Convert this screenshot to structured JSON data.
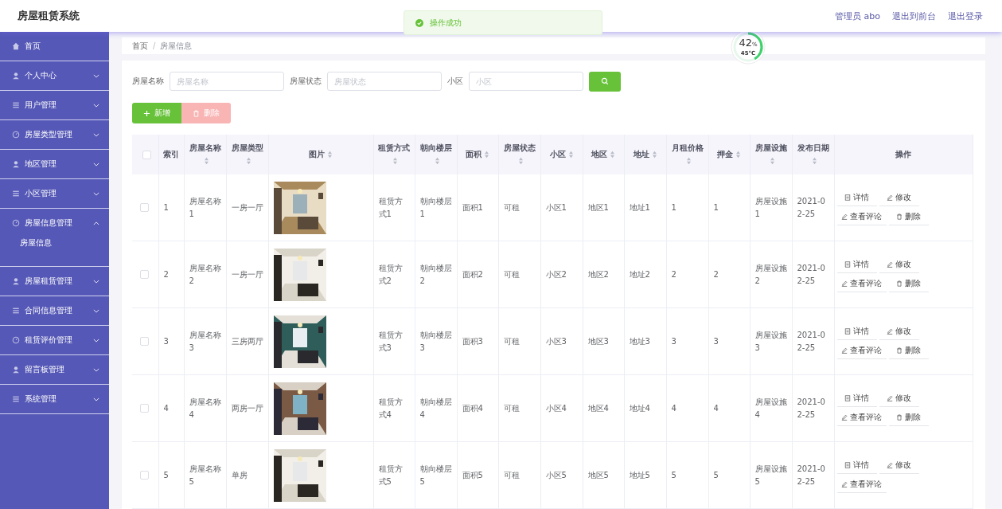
{
  "app": {
    "title": "房屋租赁系统"
  },
  "header_links": [
    "管理员 abo",
    "退出到前台",
    "退出登录"
  ],
  "toast": {
    "message": "操作成功"
  },
  "gauge": {
    "percent": "42",
    "unit": "%",
    "temperature": "45°C",
    "level": 0.42
  },
  "sidebar": {
    "items": [
      {
        "label": "首页"
      },
      {
        "label": "个人中心",
        "expanded": false
      },
      {
        "label": "用户管理",
        "expanded": false
      },
      {
        "label": "房屋类型管理",
        "expanded": false
      },
      {
        "label": "地区管理",
        "expanded": false
      },
      {
        "label": "小区管理",
        "expanded": false
      },
      {
        "label": "房屋信息管理",
        "expanded": true,
        "children": [
          {
            "label": "房屋信息"
          }
        ]
      },
      {
        "label": "房屋租赁管理",
        "expanded": false
      },
      {
        "label": "合同信息管理",
        "expanded": false
      },
      {
        "label": "租赁评价管理",
        "expanded": false
      },
      {
        "label": "留言板管理",
        "expanded": false
      },
      {
        "label": "系统管理",
        "expanded": false
      }
    ]
  },
  "breadcrumb": {
    "items": [
      "首页",
      "房屋信息"
    ],
    "separator": "/"
  },
  "search": {
    "fields": [
      {
        "label": "房屋名称",
        "placeholder": "房屋名称"
      },
      {
        "label": "房屋状态",
        "placeholder": "房屋状态"
      },
      {
        "label": "小区",
        "placeholder": "小区"
      }
    ]
  },
  "toolbar": [
    {
      "label": "新增",
      "kind": "add",
      "disabled": false
    },
    {
      "label": "删除",
      "kind": "delete",
      "disabled": true
    }
  ],
  "table": {
    "select_all_checked": false,
    "columns": [
      {
        "label": "索引",
        "sortable": false
      },
      {
        "label": "房屋名称",
        "sortable": true
      },
      {
        "label": "房屋类型",
        "sortable": true
      },
      {
        "label": "图片",
        "sortable": true
      },
      {
        "label": "租赁方式",
        "sortable": true
      },
      {
        "label": "朝向楼层",
        "sortable": true
      },
      {
        "label": "面积",
        "sortable": true
      },
      {
        "label": "房屋状态",
        "sortable": true
      },
      {
        "label": "小区",
        "sortable": true
      },
      {
        "label": "地区",
        "sortable": true
      },
      {
        "label": "地址",
        "sortable": true
      },
      {
        "label": "月租价格",
        "sortable": true
      },
      {
        "label": "押金",
        "sortable": true
      },
      {
        "label": "房屋设施",
        "sortable": true
      },
      {
        "label": "发布日期",
        "sortable": true
      },
      {
        "label": "操作",
        "sortable": false
      }
    ],
    "rows": [
      {
        "checked": false,
        "cells": [
          {
            "kind": "text",
            "text": "1"
          },
          {
            "kind": "text",
            "text": "房屋名称1"
          },
          {
            "kind": "text",
            "text": "一房一厅"
          },
          {
            "kind": "picture"
          },
          {
            "kind": "text",
            "text": "租赁方式1"
          },
          {
            "kind": "text",
            "text": "朝向楼层1"
          },
          {
            "kind": "text",
            "text": "面积1"
          },
          {
            "kind": "text",
            "text": "可租"
          },
          {
            "kind": "text",
            "text": "小区1"
          },
          {
            "kind": "text",
            "text": "地区1"
          },
          {
            "kind": "text",
            "text": "地址1"
          },
          {
            "kind": "text",
            "text": "1"
          },
          {
            "kind": "text",
            "text": "1"
          },
          {
            "kind": "text",
            "text": "房屋设施1"
          },
          {
            "kind": "date",
            "text": "2021-02-25"
          }
        ],
        "actions": [
          {
            "label": "详情",
            "kind": "detail"
          },
          {
            "label": "修改",
            "kind": "edit"
          },
          {
            "label": "查看评论",
            "kind": "edit"
          },
          {
            "label": "删除",
            "kind": "delete"
          }
        ]
      },
      {
        "checked": false,
        "cells": [
          {
            "kind": "text",
            "text": "2"
          },
          {
            "kind": "text",
            "text": "房屋名称2"
          },
          {
            "kind": "text",
            "text": "一房一厅"
          },
          {
            "kind": "picture"
          },
          {
            "kind": "text",
            "text": "租赁方式2"
          },
          {
            "kind": "text",
            "text": "朝向楼层2"
          },
          {
            "kind": "text",
            "text": "面积2"
          },
          {
            "kind": "text",
            "text": "可租"
          },
          {
            "kind": "text",
            "text": "小区2"
          },
          {
            "kind": "text",
            "text": "地区2"
          },
          {
            "kind": "text",
            "text": "地址2"
          },
          {
            "kind": "text",
            "text": "2"
          },
          {
            "kind": "text",
            "text": "2"
          },
          {
            "kind": "text",
            "text": "房屋设施2"
          },
          {
            "kind": "date",
            "text": "2021-02-25"
          }
        ],
        "actions": [
          {
            "label": "详情",
            "kind": "detail"
          },
          {
            "label": "修改",
            "kind": "edit"
          },
          {
            "label": "查看评论",
            "kind": "edit"
          },
          {
            "label": "删除",
            "kind": "delete"
          }
        ]
      },
      {
        "checked": false,
        "cells": [
          {
            "kind": "text",
            "text": "3"
          },
          {
            "kind": "text",
            "text": "房屋名称3"
          },
          {
            "kind": "text",
            "text": "三房两厅"
          },
          {
            "kind": "picture"
          },
          {
            "kind": "text",
            "text": "租赁方式3"
          },
          {
            "kind": "text",
            "text": "朝向楼层3"
          },
          {
            "kind": "text",
            "text": "面积3"
          },
          {
            "kind": "text",
            "text": "可租"
          },
          {
            "kind": "text",
            "text": "小区3"
          },
          {
            "kind": "text",
            "text": "地区3"
          },
          {
            "kind": "text",
            "text": "地址3"
          },
          {
            "kind": "text",
            "text": "3"
          },
          {
            "kind": "text",
            "text": "3"
          },
          {
            "kind": "text",
            "text": "房屋设施3"
          },
          {
            "kind": "date",
            "text": "2021-02-25"
          }
        ],
        "actions": [
          {
            "label": "详情",
            "kind": "detail"
          },
          {
            "label": "修改",
            "kind": "edit"
          },
          {
            "label": "查看评论",
            "kind": "edit"
          },
          {
            "label": "删除",
            "kind": "delete"
          }
        ]
      },
      {
        "checked": false,
        "cells": [
          {
            "kind": "text",
            "text": "4"
          },
          {
            "kind": "text",
            "text": "房屋名称4"
          },
          {
            "kind": "text",
            "text": "两房一厅"
          },
          {
            "kind": "picture"
          },
          {
            "kind": "text",
            "text": "租赁方式4"
          },
          {
            "kind": "text",
            "text": "朝向楼层4"
          },
          {
            "kind": "text",
            "text": "面积4"
          },
          {
            "kind": "text",
            "text": "可租"
          },
          {
            "kind": "text",
            "text": "小区4"
          },
          {
            "kind": "text",
            "text": "地区4"
          },
          {
            "kind": "text",
            "text": "地址4"
          },
          {
            "kind": "text",
            "text": "4"
          },
          {
            "kind": "text",
            "text": "4"
          },
          {
            "kind": "text",
            "text": "房屋设施4"
          },
          {
            "kind": "date",
            "text": "2021-02-25"
          }
        ],
        "actions": [
          {
            "label": "详情",
            "kind": "detail"
          },
          {
            "label": "修改",
            "kind": "edit"
          },
          {
            "label": "查看评论",
            "kind": "edit"
          },
          {
            "label": "删除",
            "kind": "delete"
          }
        ]
      },
      {
        "checked": false,
        "cells": [
          {
            "kind": "text",
            "text": "5"
          },
          {
            "kind": "text",
            "text": "房屋名称5"
          },
          {
            "kind": "text",
            "text": "单房"
          },
          {
            "kind": "picture"
          },
          {
            "kind": "text",
            "text": "租赁方式5"
          },
          {
            "kind": "text",
            "text": "朝向楼层5"
          },
          {
            "kind": "text",
            "text": "面积5"
          },
          {
            "kind": "text",
            "text": "可租"
          },
          {
            "kind": "text",
            "text": "小区5"
          },
          {
            "kind": "text",
            "text": "地区5"
          },
          {
            "kind": "text",
            "text": "地址5"
          },
          {
            "kind": "text",
            "text": "5"
          },
          {
            "kind": "text",
            "text": "5"
          },
          {
            "kind": "text",
            "text": "房屋设施5"
          },
          {
            "kind": "date",
            "text": "2021-02-25"
          }
        ],
        "actions": [
          {
            "label": "详情",
            "kind": "detail"
          },
          {
            "label": "修改",
            "kind": "edit"
          },
          {
            "label": "查看评论",
            "kind": "edit"
          }
        ]
      }
    ]
  }
}
